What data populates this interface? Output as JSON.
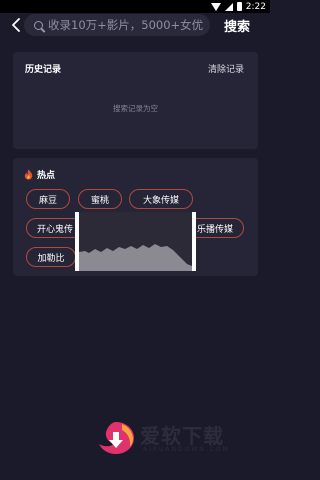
{
  "status_bar": {
    "time": "2:22"
  },
  "top_bar": {
    "search_placeholder": "收录10万+影片，5000+女优",
    "search_label": "搜索"
  },
  "history": {
    "title": "历史记录",
    "clear_label": "清除记录",
    "empty_text": "搜索记录为空"
  },
  "hot": {
    "title": "热点",
    "tags": [
      "麻豆",
      "蜜桃",
      "大象传媒",
      "开心鬼传",
      "乐播传媒",
      "加勒比"
    ]
  },
  "watermark": {
    "text": "爱软下载",
    "sub": "AIRUANDOWN.COM"
  },
  "colors": {
    "background": "#1b1a2b",
    "card": "#262537",
    "tag_border": "#b04a3a",
    "accent": "#e2542f"
  }
}
